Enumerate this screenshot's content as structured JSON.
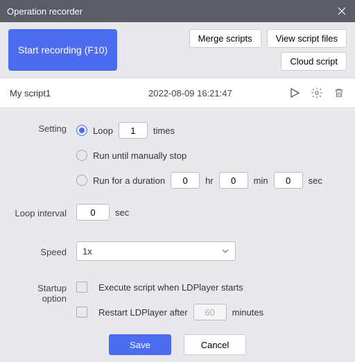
{
  "window": {
    "title": "Operation recorder"
  },
  "toolbar": {
    "start_recording": "Start recording (F10)",
    "merge_scripts": "Merge scripts",
    "view_script_files": "View script files",
    "cloud_script": "Cloud script"
  },
  "script": {
    "name": "My script1",
    "time": "2022-08-09 16:21:47"
  },
  "labels": {
    "setting": "Setting",
    "loop_interval": "Loop interval",
    "speed": "Speed",
    "startup_option": "Startup option",
    "loop": "Loop",
    "times": "times",
    "run_until": "Run until manually stop",
    "run_for": "Run for a duration",
    "hr": "hr",
    "min": "min",
    "sec": "sec",
    "exec_on_start": "Execute script when LDPlayer starts",
    "restart_after": "Restart LDPlayer after",
    "minutes": "minutes"
  },
  "values": {
    "loop_times": "1",
    "dur_hr": "0",
    "dur_min": "0",
    "dur_sec": "0",
    "loop_interval": "0",
    "speed": "1x",
    "restart_minutes": "60"
  },
  "buttons": {
    "save": "Save",
    "cancel": "Cancel"
  }
}
